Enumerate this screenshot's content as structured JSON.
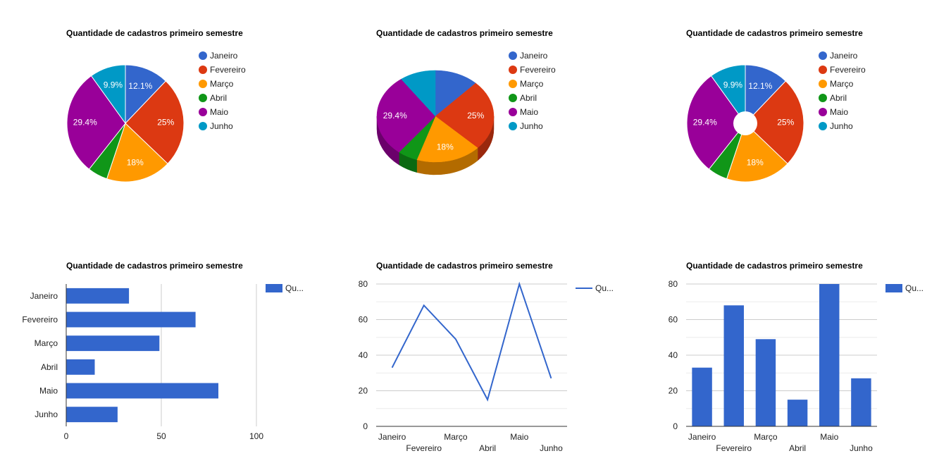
{
  "chart_data": [
    {
      "type": "pie",
      "variant": "pie",
      "title": "Quantidade de cadastros primeiro semestre",
      "categories": [
        "Janeiro",
        "Fevereiro",
        "Março",
        "Abril",
        "Maio",
        "Junho"
      ],
      "values": [
        33,
        68,
        49,
        15,
        80,
        27
      ],
      "slice_labels": [
        "12.1%",
        "25%",
        "18%",
        "",
        "29.4%",
        "9.9%"
      ],
      "legend_position": "right"
    },
    {
      "type": "pie",
      "variant": "3d",
      "title": "Quantidade de cadastros primeiro semestre",
      "categories": [
        "Janeiro",
        "Fevereiro",
        "Março",
        "Abril",
        "Maio",
        "Junho"
      ],
      "values": [
        33,
        68,
        49,
        15,
        80,
        27
      ],
      "slice_labels": [
        "",
        "25%",
        "18%",
        "",
        "29.4%",
        ""
      ],
      "legend_position": "right"
    },
    {
      "type": "pie",
      "variant": "donut",
      "title": "Quantidade de cadastros primeiro semestre",
      "categories": [
        "Janeiro",
        "Fevereiro",
        "Março",
        "Abril",
        "Maio",
        "Junho"
      ],
      "values": [
        33,
        68,
        49,
        15,
        80,
        27
      ],
      "slice_labels": [
        "12.1%",
        "25%",
        "18%",
        "",
        "29.4%",
        "9.9%"
      ],
      "legend_position": "right"
    },
    {
      "type": "bar",
      "orientation": "horizontal",
      "title": "Quantidade de cadastros primeiro semestre",
      "categories": [
        "Janeiro",
        "Fevereiro",
        "Março",
        "Abril",
        "Maio",
        "Junho"
      ],
      "series": [
        {
          "name": "Qu...",
          "values": [
            33,
            68,
            49,
            15,
            80,
            27
          ]
        }
      ],
      "xlim": [
        0,
        100
      ],
      "xticks": [
        0,
        50,
        100
      ],
      "grid": true,
      "legend_position": "right"
    },
    {
      "type": "line",
      "title": "Quantidade de cadastros primeiro semestre",
      "categories": [
        "Janeiro",
        "Fevereiro",
        "Março",
        "Abril",
        "Maio",
        "Junho"
      ],
      "series": [
        {
          "name": "Qu...",
          "values": [
            33,
            68,
            49,
            15,
            80,
            27
          ]
        }
      ],
      "ylim": [
        0,
        80
      ],
      "yticks": [
        0,
        20,
        40,
        60,
        80
      ],
      "grid": true,
      "legend_position": "right"
    },
    {
      "type": "bar",
      "orientation": "vertical",
      "title": "Quantidade de cadastros primeiro semestre",
      "categories": [
        "Janeiro",
        "Fevereiro",
        "Março",
        "Abril",
        "Maio",
        "Junho"
      ],
      "series": [
        {
          "name": "Qu...",
          "values": [
            33,
            68,
            49,
            15,
            80,
            27
          ]
        }
      ],
      "ylim": [
        0,
        80
      ],
      "yticks": [
        0,
        20,
        40,
        60,
        80
      ],
      "grid": true,
      "legend_position": "right"
    }
  ],
  "colors": {
    "slices": [
      "#3366cc",
      "#dc3912",
      "#ff9900",
      "#109618",
      "#990099",
      "#0099c6"
    ],
    "slices_side": [
      "#24478f",
      "#9a280d",
      "#b36b00",
      "#0b6911",
      "#6b006b",
      "#006b8b"
    ],
    "series": "#3366cc",
    "grid": "#cccccc",
    "axis": "#333333"
  }
}
